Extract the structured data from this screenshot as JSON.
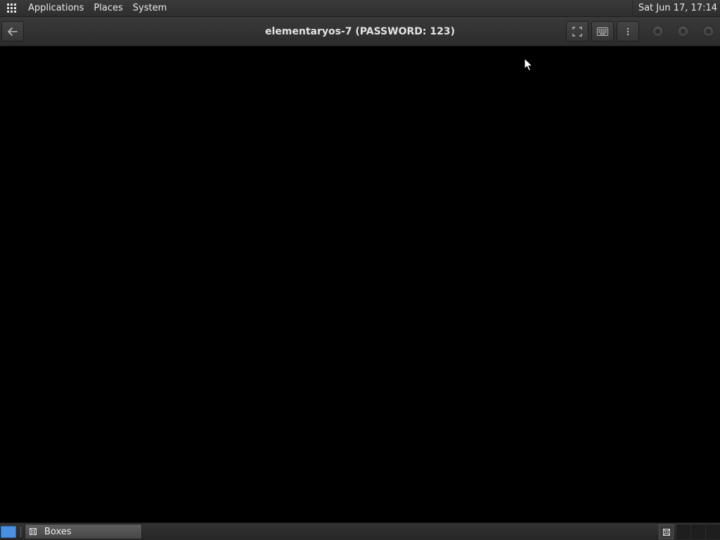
{
  "top_panel": {
    "menus": [
      "Applications",
      "Places",
      "System"
    ],
    "clock": "Sat Jun 17, 17:14",
    "apps_icon": "app-grid-icon"
  },
  "header": {
    "title": "elementaryos-7 (PASSWORD: 123)",
    "back_icon": "arrow-left-icon",
    "buttons": [
      "fullscreen-icon",
      "keyboard-icon",
      "kebab-menu-icon"
    ],
    "window_controls": [
      "minimize",
      "maximize",
      "close"
    ]
  },
  "vm_display": {
    "background": "#000000"
  },
  "bottom_panel": {
    "tasks": [
      {
        "label": "Boxes",
        "icon": "boxes-app-icon",
        "active": true
      }
    ],
    "show_desktop_color": "#4a8fe0",
    "workspaces": 3
  },
  "colors": {
    "panel": "#2e2e2e",
    "header": "#333333",
    "accent": "#4a8fe0"
  }
}
